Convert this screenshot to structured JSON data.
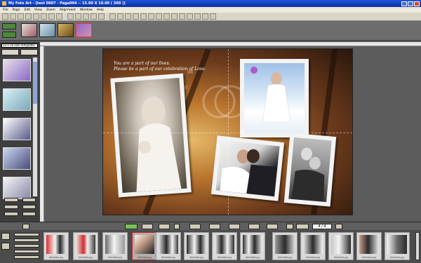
{
  "window": {
    "title": "My Foto Art - [test 0007 - Page004 -- 15.00 X 10.00 ( 300 )]"
  },
  "menu": [
    "File",
    "Page",
    "Edit",
    "View",
    "Zoom",
    "Alignment",
    "Window",
    "Help"
  ],
  "left_panel": {
    "combo_value": "13 x 10 size Templates"
  },
  "canvas": {
    "poem_line1": "You are a part of our lives.",
    "poem_line2": "Please be a part of our celebration of Love."
  },
  "page_navigator": {
    "value": "4 / 4"
  },
  "filmstrip": [
    {
      "caption": "PICT0001.jpg",
      "selected": false
    },
    {
      "caption": "PICT0002.jpg",
      "selected": false
    },
    {
      "caption": "PICT0003.jpg",
      "selected": false
    },
    {
      "caption": "PICT0004.jpg",
      "selected": true
    },
    {
      "caption": "PICT0005.jpg",
      "selected": false
    },
    {
      "caption": "PICT0006.jpg",
      "selected": false
    },
    {
      "caption": "PICT0007.jpg",
      "selected": false
    },
    {
      "caption": "PICT0008.jpg",
      "selected": false
    },
    {
      "caption": "PICT0009.jpg",
      "selected": false
    },
    {
      "caption": "PICT0010.jpg",
      "selected": false
    },
    {
      "caption": "PICT0011.jpg",
      "selected": false
    },
    {
      "caption": "PICT0012.jpg",
      "selected": false
    },
    {
      "caption": "PICT0013.jpg",
      "selected": false
    },
    {
      "caption": "PICT0014.jpg",
      "selected": false
    }
  ],
  "colors": {
    "titlebar": "#0a2fa8",
    "workspace": "#5c5c5c",
    "selection_border": "#d02020"
  }
}
